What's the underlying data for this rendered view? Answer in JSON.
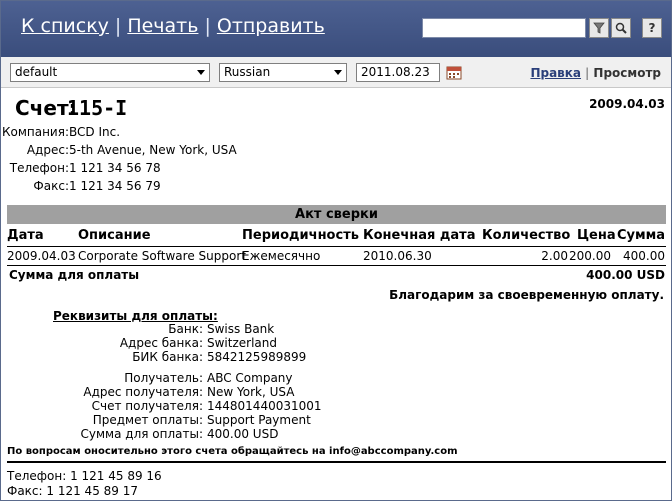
{
  "header": {
    "links": [
      "К списку",
      "Печать",
      "Отправить"
    ],
    "search_placeholder": "",
    "help_label": "?"
  },
  "toolbar": {
    "template": "default",
    "language": "Russian",
    "date": "2011.08.23",
    "edit_label": "Правка",
    "separator": "|",
    "view_label": "Просмотр"
  },
  "invoice": {
    "label": "Счет:",
    "number": "115-I",
    "date": "2009.04.03"
  },
  "company": [
    {
      "k": "Компания:",
      "v": "BCD Inc."
    },
    {
      "k": "Адрес:",
      "v": "5-th Avenue, New York, USA"
    },
    {
      "k": "Телефон:",
      "v": "1 121 34 56 78"
    },
    {
      "k": "Факс:",
      "v": "1 121 34 56 79"
    }
  ],
  "section_title": "Акт сверки",
  "table": {
    "headers": [
      "Дата",
      "Описание",
      "Периодичность",
      "Конечная дата",
      "Количество",
      "Цена",
      "Сумма"
    ],
    "rows": [
      [
        "2009.04.03",
        "Corporate Software Support",
        "Ежемесячно",
        "2010.06.30",
        "2.00",
        "200.00",
        "400.00"
      ]
    ]
  },
  "total": {
    "label": "Сумма для оплаты",
    "value": "400.00 USD"
  },
  "thanks": "Благодарим за своевременную оплату.",
  "requisites": {
    "title": "Реквизиты для оплаты:",
    "bank": [
      {
        "k": "Банк:",
        "v": "Swiss Bank"
      },
      {
        "k": "Адрес банка:",
        "v": "Switzerland"
      },
      {
        "k": "БИК банка:",
        "v": "5842125989899"
      }
    ],
    "payee": [
      {
        "k": "Получатель:",
        "v": "ABC Company"
      },
      {
        "k": "Адрес получателя:",
        "v": "New York, USA"
      },
      {
        "k": "Счет получателя:",
        "v": "144801440031001"
      },
      {
        "k": "Предмет оплаты:",
        "v": "Support Payment"
      },
      {
        "k": "Сумма для оплаты:",
        "v": "400.00 USD"
      }
    ]
  },
  "contact_note": "По вопросам оносительно этого счета обращайтесь на info@abccompany.com",
  "footer": [
    "Телефон: 1 121 45 89 16",
    "Факс: 1 121 45 89 17"
  ],
  "colors": {
    "header_bg": "#435888",
    "section_bg": "#a0a0a0",
    "link": "#2a3f7a"
  }
}
